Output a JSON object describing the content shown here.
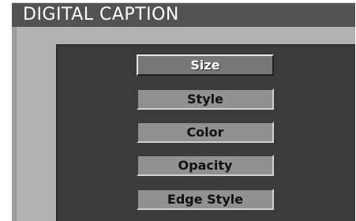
{
  "header": {
    "title": "DIGITAL CAPTION"
  },
  "menu": {
    "selected_index": 0,
    "items": [
      {
        "label": "Size"
      },
      {
        "label": "Style"
      },
      {
        "label": "Color"
      },
      {
        "label": "Opacity"
      },
      {
        "label": "Edge Style"
      }
    ]
  },
  "colors": {
    "title_bar": "#525252",
    "frame": "#b2b2b2",
    "panel": "#3b3b3b",
    "item": "#919191",
    "item_selected": "#777777"
  }
}
